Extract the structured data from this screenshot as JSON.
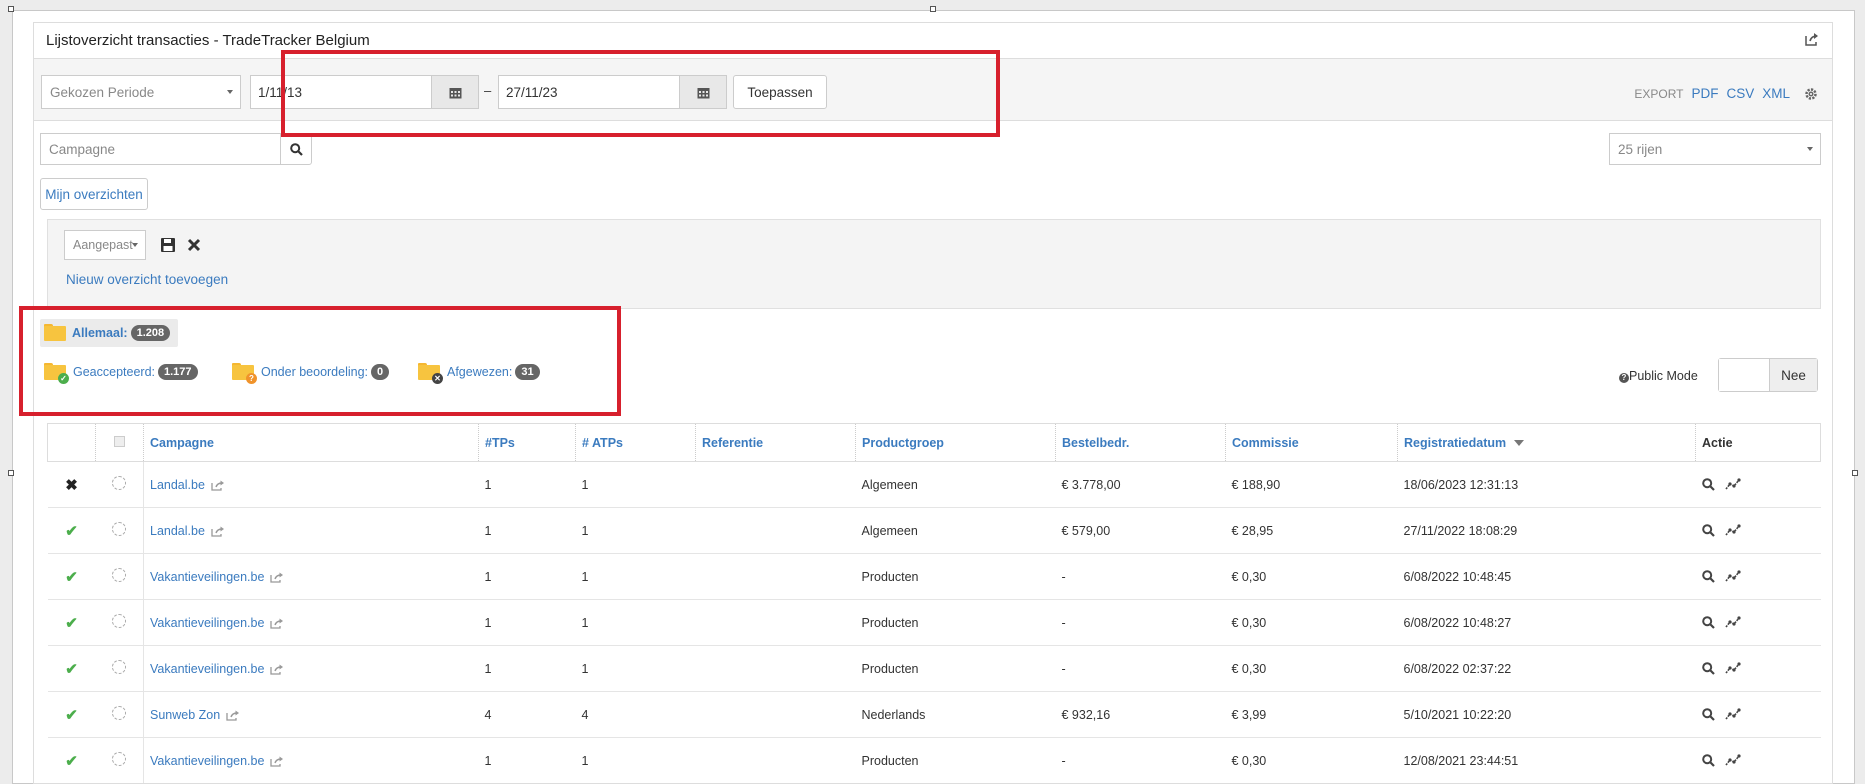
{
  "panel": {
    "title": "Lijstoverzicht transacties - TradeTracker Belgium"
  },
  "filter": {
    "period_select": "Gekozen Periode",
    "date_from": "1/11/13",
    "date_sep": "–",
    "date_to": "27/11/23",
    "apply_label": "Toepassen",
    "export_label": "EXPORT",
    "export_pdf": "PDF",
    "export_csv": "CSV",
    "export_xml": "XML"
  },
  "search": {
    "placeholder": "Campagne",
    "rows_select": "25 rijen"
  },
  "views": {
    "my_overviews_label": "Mijn overzichten",
    "custom_select": "Aangepast",
    "add_link": "Nieuw overzicht toevoegen"
  },
  "statuses": {
    "all": {
      "label": "Allemaal:",
      "count": "1.208"
    },
    "accepted": {
      "label": "Geaccepteerd:",
      "count": "1.177"
    },
    "pending": {
      "label": "Onder beoordeling:",
      "count": "0"
    },
    "rejected": {
      "label": "Afgewezen:",
      "count": "31"
    }
  },
  "public_mode": {
    "label": "Public Mode",
    "value": "Nee"
  },
  "table": {
    "headers": {
      "campaign": "Campagne",
      "tps": "#TPs",
      "atps": "# ATPs",
      "reference": "Referentie",
      "product_group": "Productgroep",
      "order_amount": "Bestelbedr.",
      "commission": "Commissie",
      "reg_date": "Registratiedatum",
      "action": "Actie"
    },
    "rows": [
      {
        "status": "rejected",
        "campaign": "Landal.be",
        "tps": "1",
        "atps": "1",
        "reference": "",
        "product_group": "Algemeen",
        "order_amount": "€ 3.778,00",
        "commission": "€ 188,90",
        "reg_date": "18/06/2023 12:31:13"
      },
      {
        "status": "accepted",
        "campaign": "Landal.be",
        "tps": "1",
        "atps": "1",
        "reference": "",
        "product_group": "Algemeen",
        "order_amount": "€ 579,00",
        "commission": "€ 28,95",
        "reg_date": "27/11/2022 18:08:29"
      },
      {
        "status": "accepted",
        "campaign": "Vakantieveilingen.be",
        "tps": "1",
        "atps": "1",
        "reference": "",
        "product_group": "Producten",
        "order_amount": "-",
        "commission": "€ 0,30",
        "reg_date": "6/08/2022 10:48:45"
      },
      {
        "status": "accepted",
        "campaign": "Vakantieveilingen.be",
        "tps": "1",
        "atps": "1",
        "reference": "",
        "product_group": "Producten",
        "order_amount": "-",
        "commission": "€ 0,30",
        "reg_date": "6/08/2022 10:48:27"
      },
      {
        "status": "accepted",
        "campaign": "Vakantieveilingen.be",
        "tps": "1",
        "atps": "1",
        "reference": "",
        "product_group": "Producten",
        "order_amount": "-",
        "commission": "€ 0,30",
        "reg_date": "6/08/2022 02:37:22"
      },
      {
        "status": "accepted",
        "campaign": "Sunweb Zon",
        "tps": "4",
        "atps": "4",
        "reference": "",
        "product_group": "Nederlands",
        "order_amount": "€ 932,16",
        "commission": "€ 3,99",
        "reg_date": "5/10/2021 10:22:20"
      },
      {
        "status": "accepted",
        "campaign": "Vakantieveilingen.be",
        "tps": "1",
        "atps": "1",
        "reference": "",
        "product_group": "Producten",
        "order_amount": "-",
        "commission": "€ 0,30",
        "reg_date": "12/08/2021 23:44:51"
      }
    ]
  },
  "colors": {
    "link": "#3b7bbf",
    "highlight": "#d7202d",
    "accepted": "#4cae4c",
    "folder": "#f7c43f"
  }
}
